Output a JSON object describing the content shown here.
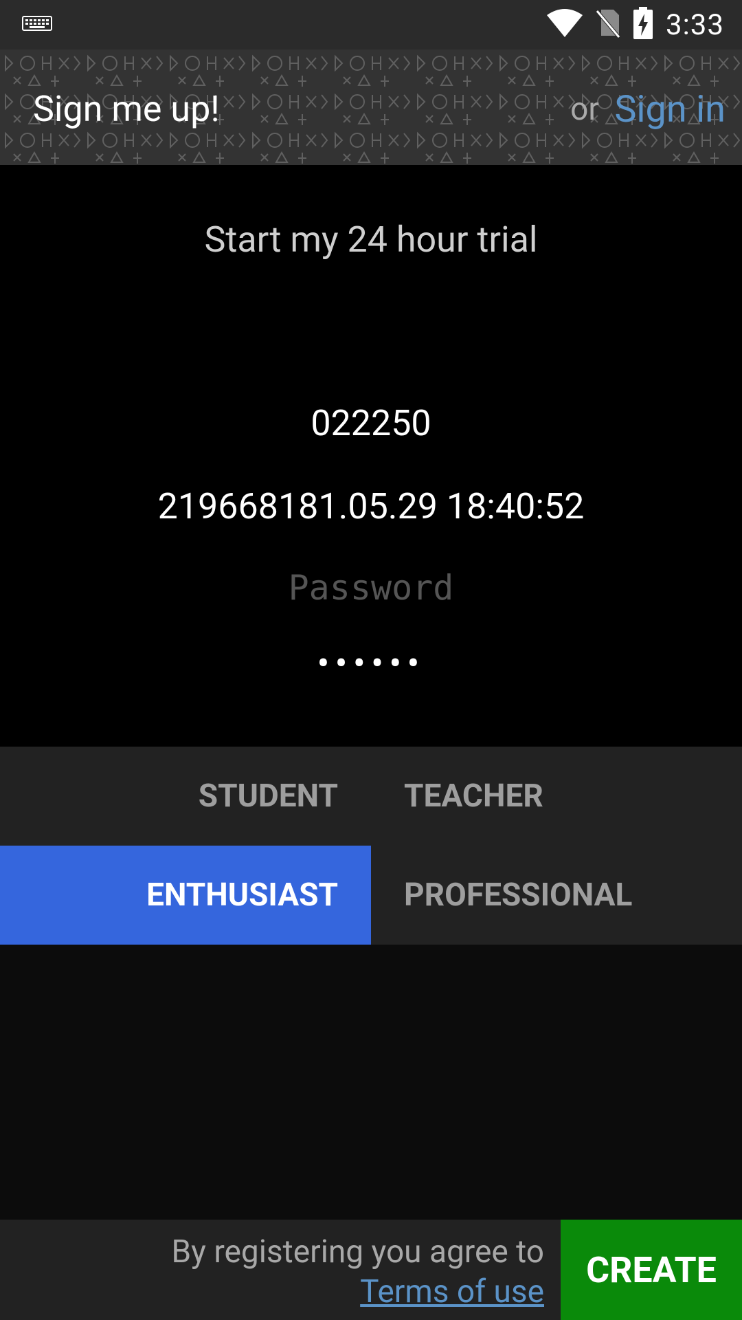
{
  "status_bar": {
    "time": "3:33",
    "icons": [
      "keyboard-icon",
      "wifi-icon",
      "no-sim-icon",
      "battery-charging-icon"
    ]
  },
  "header": {
    "title": "Sign me up!",
    "or_text": "or",
    "signin_label": "Sign in"
  },
  "form": {
    "trial_text": "Start my 24 hour trial",
    "username_value": "022250",
    "email_value": "219668181.05.29 18:40:52",
    "password_placeholder": "Password",
    "password_value": "••••••"
  },
  "roles": {
    "items": [
      {
        "label": "STUDENT",
        "selected": false
      },
      {
        "label": "TEACHER",
        "selected": false
      },
      {
        "label": "ENTHUSIAST",
        "selected": true
      },
      {
        "label": "PROFESSIONAL",
        "selected": false
      }
    ]
  },
  "footer": {
    "agree_text": "By registering you agree to",
    "terms_label": "Terms of use",
    "create_label": "CREATE"
  },
  "colors": {
    "accent_link": "#5b93c8",
    "selected_role": "#3566dd",
    "create_button": "#0a8a0a"
  }
}
